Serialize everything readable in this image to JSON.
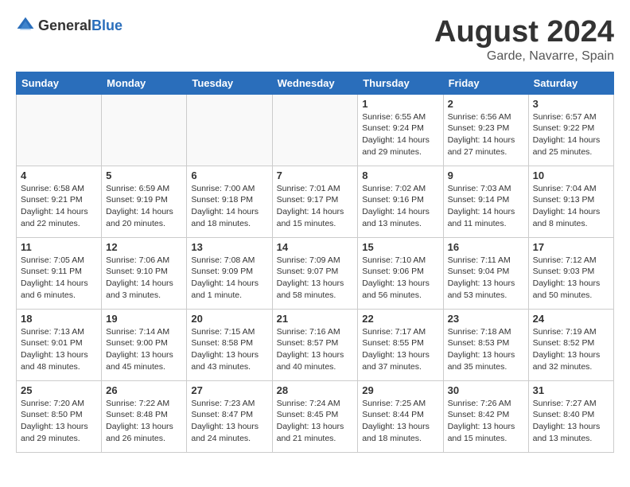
{
  "header": {
    "logo_general": "General",
    "logo_blue": "Blue",
    "title": "August 2024",
    "subtitle": "Garde, Navarre, Spain"
  },
  "weekdays": [
    "Sunday",
    "Monday",
    "Tuesday",
    "Wednesday",
    "Thursday",
    "Friday",
    "Saturday"
  ],
  "weeks": [
    [
      {
        "day": "",
        "info": ""
      },
      {
        "day": "",
        "info": ""
      },
      {
        "day": "",
        "info": ""
      },
      {
        "day": "",
        "info": ""
      },
      {
        "day": "1",
        "info": "Sunrise: 6:55 AM\nSunset: 9:24 PM\nDaylight: 14 hours\nand 29 minutes."
      },
      {
        "day": "2",
        "info": "Sunrise: 6:56 AM\nSunset: 9:23 PM\nDaylight: 14 hours\nand 27 minutes."
      },
      {
        "day": "3",
        "info": "Sunrise: 6:57 AM\nSunset: 9:22 PM\nDaylight: 14 hours\nand 25 minutes."
      }
    ],
    [
      {
        "day": "4",
        "info": "Sunrise: 6:58 AM\nSunset: 9:21 PM\nDaylight: 14 hours\nand 22 minutes."
      },
      {
        "day": "5",
        "info": "Sunrise: 6:59 AM\nSunset: 9:19 PM\nDaylight: 14 hours\nand 20 minutes."
      },
      {
        "day": "6",
        "info": "Sunrise: 7:00 AM\nSunset: 9:18 PM\nDaylight: 14 hours\nand 18 minutes."
      },
      {
        "day": "7",
        "info": "Sunrise: 7:01 AM\nSunset: 9:17 PM\nDaylight: 14 hours\nand 15 minutes."
      },
      {
        "day": "8",
        "info": "Sunrise: 7:02 AM\nSunset: 9:16 PM\nDaylight: 14 hours\nand 13 minutes."
      },
      {
        "day": "9",
        "info": "Sunrise: 7:03 AM\nSunset: 9:14 PM\nDaylight: 14 hours\nand 11 minutes."
      },
      {
        "day": "10",
        "info": "Sunrise: 7:04 AM\nSunset: 9:13 PM\nDaylight: 14 hours\nand 8 minutes."
      }
    ],
    [
      {
        "day": "11",
        "info": "Sunrise: 7:05 AM\nSunset: 9:11 PM\nDaylight: 14 hours\nand 6 minutes."
      },
      {
        "day": "12",
        "info": "Sunrise: 7:06 AM\nSunset: 9:10 PM\nDaylight: 14 hours\nand 3 minutes."
      },
      {
        "day": "13",
        "info": "Sunrise: 7:08 AM\nSunset: 9:09 PM\nDaylight: 14 hours\nand 1 minute."
      },
      {
        "day": "14",
        "info": "Sunrise: 7:09 AM\nSunset: 9:07 PM\nDaylight: 13 hours\nand 58 minutes."
      },
      {
        "day": "15",
        "info": "Sunrise: 7:10 AM\nSunset: 9:06 PM\nDaylight: 13 hours\nand 56 minutes."
      },
      {
        "day": "16",
        "info": "Sunrise: 7:11 AM\nSunset: 9:04 PM\nDaylight: 13 hours\nand 53 minutes."
      },
      {
        "day": "17",
        "info": "Sunrise: 7:12 AM\nSunset: 9:03 PM\nDaylight: 13 hours\nand 50 minutes."
      }
    ],
    [
      {
        "day": "18",
        "info": "Sunrise: 7:13 AM\nSunset: 9:01 PM\nDaylight: 13 hours\nand 48 minutes."
      },
      {
        "day": "19",
        "info": "Sunrise: 7:14 AM\nSunset: 9:00 PM\nDaylight: 13 hours\nand 45 minutes."
      },
      {
        "day": "20",
        "info": "Sunrise: 7:15 AM\nSunset: 8:58 PM\nDaylight: 13 hours\nand 43 minutes."
      },
      {
        "day": "21",
        "info": "Sunrise: 7:16 AM\nSunset: 8:57 PM\nDaylight: 13 hours\nand 40 minutes."
      },
      {
        "day": "22",
        "info": "Sunrise: 7:17 AM\nSunset: 8:55 PM\nDaylight: 13 hours\nand 37 minutes."
      },
      {
        "day": "23",
        "info": "Sunrise: 7:18 AM\nSunset: 8:53 PM\nDaylight: 13 hours\nand 35 minutes."
      },
      {
        "day": "24",
        "info": "Sunrise: 7:19 AM\nSunset: 8:52 PM\nDaylight: 13 hours\nand 32 minutes."
      }
    ],
    [
      {
        "day": "25",
        "info": "Sunrise: 7:20 AM\nSunset: 8:50 PM\nDaylight: 13 hours\nand 29 minutes."
      },
      {
        "day": "26",
        "info": "Sunrise: 7:22 AM\nSunset: 8:48 PM\nDaylight: 13 hours\nand 26 minutes."
      },
      {
        "day": "27",
        "info": "Sunrise: 7:23 AM\nSunset: 8:47 PM\nDaylight: 13 hours\nand 24 minutes."
      },
      {
        "day": "28",
        "info": "Sunrise: 7:24 AM\nSunset: 8:45 PM\nDaylight: 13 hours\nand 21 minutes."
      },
      {
        "day": "29",
        "info": "Sunrise: 7:25 AM\nSunset: 8:44 PM\nDaylight: 13 hours\nand 18 minutes."
      },
      {
        "day": "30",
        "info": "Sunrise: 7:26 AM\nSunset: 8:42 PM\nDaylight: 13 hours\nand 15 minutes."
      },
      {
        "day": "31",
        "info": "Sunrise: 7:27 AM\nSunset: 8:40 PM\nDaylight: 13 hours\nand 13 minutes."
      }
    ]
  ]
}
